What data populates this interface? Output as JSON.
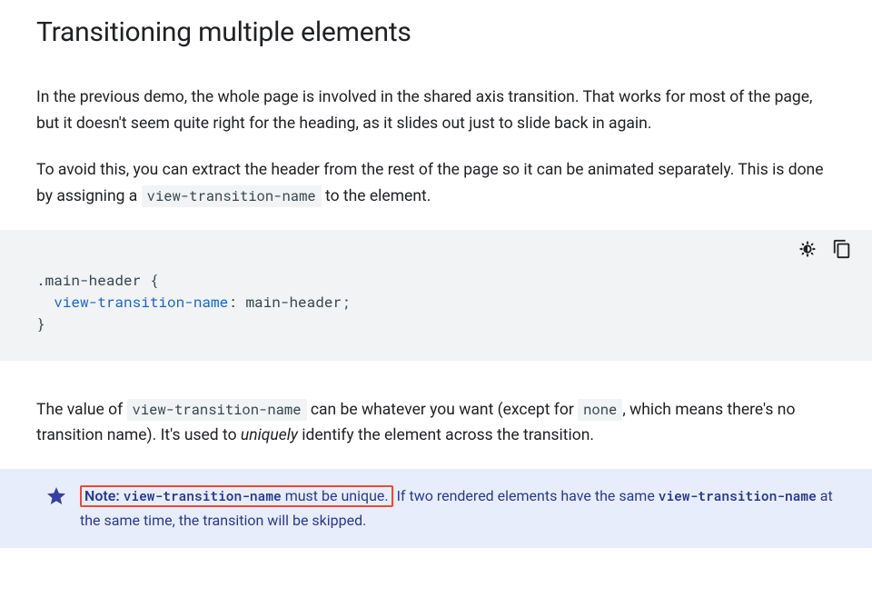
{
  "heading": "Transitioning multiple elements",
  "para1": "In the previous demo, the whole page is involved in the shared axis transition. That works for most of the page, but it doesn't seem quite right for the heading, as it slides out just to slide back in again.",
  "para2_a": "To avoid this, you can extract the header from the rest of the page so it can be animated separately. This is done by assigning a ",
  "para2_code": "view-transition-name",
  "para2_b": " to the element.",
  "code": {
    "selector": ".main-header",
    "property": "view-transition-name",
    "value": "main-header"
  },
  "para3_a": "The value of ",
  "para3_code1": "view-transition-name",
  "para3_b": " can be whatever you want (except for ",
  "para3_code2": "none",
  "para3_c": ", which means there's no transition name). It's used to ",
  "para3_em": "uniquely",
  "para3_d": " identify the element across the transition.",
  "note": {
    "label": "Note:",
    "hl_code": "view-transition-name",
    "hl_tail": " must be unique.",
    "rest_a": " If two rendered elements have the same ",
    "rest_code": "view-transition-name",
    "rest_b": " at the same time, the transition will be skipped."
  }
}
